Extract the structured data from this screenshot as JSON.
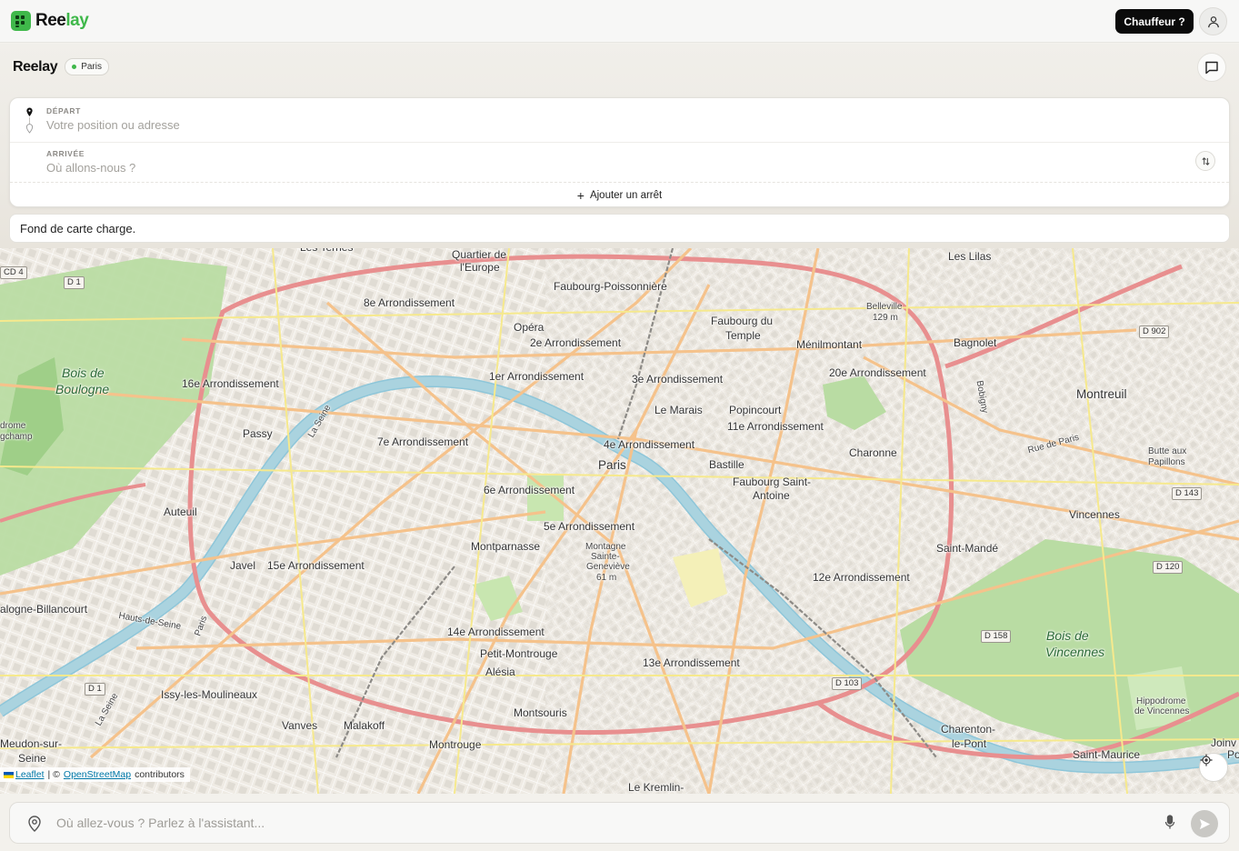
{
  "topbar": {
    "logo_part1": "Ree",
    "logo_part2": "lay",
    "driver_button": "Chauffeur ?",
    "icons": {
      "logo": "logo-icon",
      "user": "user-icon"
    }
  },
  "header": {
    "title": "Reelay",
    "city": "Paris",
    "icons": {
      "chat": "chat-bubble-icon"
    }
  },
  "route": {
    "departure_label": "DÉPART",
    "departure_placeholder": "Votre position ou adresse",
    "arrival_label": "ARRIVÉE",
    "arrival_placeholder": "Où allons-nous ?",
    "add_stop": "Ajouter un arrêt",
    "icons": {
      "departure": "map-pin-icon",
      "arrival": "map-pin-outline-icon",
      "swap": "swap-vertical-icon",
      "add": "plus-icon"
    }
  },
  "toast": {
    "message": "Fond de carte charge."
  },
  "map": {
    "labels": [
      {
        "text": "Quartier de",
        "cls": ""
      },
      {
        "text": "l'Europe",
        "cls": ""
      },
      {
        "text": "Faubourg-Poissonnière",
        "cls": ""
      },
      {
        "text": "Les Lilas",
        "cls": ""
      },
      {
        "text": "8e Arrondissement",
        "cls": ""
      },
      {
        "text": "Opéra",
        "cls": ""
      },
      {
        "text": "Faubourg du",
        "cls": ""
      },
      {
        "text": "Temple",
        "cls": ""
      },
      {
        "text": "Belleville",
        "cls": "small"
      },
      {
        "text": "129 m",
        "cls": "small"
      },
      {
        "text": "Ménilmontant",
        "cls": ""
      },
      {
        "text": "Bagnolet",
        "cls": ""
      },
      {
        "text": "2e Arrondissement",
        "cls": ""
      },
      {
        "text": "Bois de",
        "cls": "green"
      },
      {
        "text": "Boulogne",
        "cls": "green"
      },
      {
        "text": "1er Arrondissement",
        "cls": ""
      },
      {
        "text": "3e Arrondissement",
        "cls": ""
      },
      {
        "text": "20e Arrondissement",
        "cls": ""
      },
      {
        "text": "16e Arrondissement",
        "cls": ""
      },
      {
        "text": "Montreuil",
        "cls": "big"
      },
      {
        "text": "Le Marais",
        "cls": ""
      },
      {
        "text": "Popincourt",
        "cls": ""
      },
      {
        "text": "11e Arrondissement",
        "cls": ""
      },
      {
        "text": "Passy",
        "cls": ""
      },
      {
        "text": "7e Arrondissement",
        "cls": ""
      },
      {
        "text": "4e Arrondissement",
        "cls": ""
      },
      {
        "text": "Charonne",
        "cls": ""
      },
      {
        "text": "Butte aux",
        "cls": "small"
      },
      {
        "text": "Papillons",
        "cls": "small"
      },
      {
        "text": "Paris",
        "cls": "big"
      },
      {
        "text": "Bastille",
        "cls": ""
      },
      {
        "text": "Faubourg Saint-",
        "cls": ""
      },
      {
        "text": "Antoine",
        "cls": ""
      },
      {
        "text": "6e Arrondissement",
        "cls": ""
      },
      {
        "text": "Auteuil",
        "cls": ""
      },
      {
        "text": "Vincennes",
        "cls": ""
      },
      {
        "text": "5e Arrondissement",
        "cls": ""
      },
      {
        "text": "Montparnasse",
        "cls": ""
      },
      {
        "text": "Montagne",
        "cls": "small"
      },
      {
        "text": "Sainte-",
        "cls": "small"
      },
      {
        "text": "Geneviève",
        "cls": "small"
      },
      {
        "text": "61 m",
        "cls": "small"
      },
      {
        "text": "Saint-Mandé",
        "cls": ""
      },
      {
        "text": "Javel",
        "cls": ""
      },
      {
        "text": "15e Arrondissement",
        "cls": ""
      },
      {
        "text": "12e Arrondissement",
        "cls": ""
      },
      {
        "text": "alogne-Billancourt",
        "cls": ""
      },
      {
        "text": "14e Arrondissement",
        "cls": ""
      },
      {
        "text": "Bois de",
        "cls": "green"
      },
      {
        "text": "Vincennes",
        "cls": "green"
      },
      {
        "text": "Petit-Montrouge",
        "cls": ""
      },
      {
        "text": "13e Arrondissement",
        "cls": ""
      },
      {
        "text": "Alésia",
        "cls": ""
      },
      {
        "text": "Issy-les-Moulineaux",
        "cls": ""
      },
      {
        "text": "Hippodrome",
        "cls": "small"
      },
      {
        "text": "de Vincennes",
        "cls": "small"
      },
      {
        "text": "Vanves",
        "cls": ""
      },
      {
        "text": "Malakoff",
        "cls": ""
      },
      {
        "text": "Montsouris",
        "cls": ""
      },
      {
        "text": "Charenton-",
        "cls": ""
      },
      {
        "text": "le-Pont",
        "cls": ""
      },
      {
        "text": "Meudon-sur-",
        "cls": ""
      },
      {
        "text": "Seine",
        "cls": ""
      },
      {
        "text": "Montrouge",
        "cls": ""
      },
      {
        "text": "Saint-Maurice",
        "cls": ""
      },
      {
        "text": "Le Kremlin-",
        "cls": ""
      },
      {
        "text": "Les Ternes",
        "cls": ""
      },
      {
        "text": "Joinv",
        "cls": ""
      },
      {
        "text": "drome",
        "cls": "small"
      },
      {
        "text": "gchamp",
        "cls": "small"
      },
      {
        "text": "La Seine",
        "cls": "small"
      },
      {
        "text": "Bobigny",
        "cls": "small"
      },
      {
        "text": "Rue de Paris",
        "cls": "small"
      },
      {
        "text": "Hauts-de-Seine",
        "cls": "small"
      },
      {
        "text": "Paris",
        "cls": "small"
      },
      {
        "text": "La Seine",
        "cls": "small"
      },
      {
        "text": "Po",
        "cls": ""
      }
    ],
    "road_badges": [
      "CD 4",
      "D 1",
      "D 902",
      "D 143",
      "D 120",
      "D 158",
      "D 103",
      "D 1"
    ],
    "attribution": {
      "leaflet": "Leaflet",
      "separator": "| ©",
      "osm": "OpenStreetMap",
      "contributors": "contributors"
    },
    "icons": {
      "locate": "crosshair-locate-icon"
    }
  },
  "assistant": {
    "placeholder": "Où allez-vous ? Parlez à l'assistant...",
    "icons": {
      "pin": "map-pin-outline-icon",
      "mic": "microphone-icon",
      "send": "send-icon"
    }
  },
  "colors": {
    "brand_green": "#3fb84a",
    "dark_button": "#0b0b0b",
    "water": "#aad3df",
    "park": "#c8e6b0",
    "major_road": "#f7c38a",
    "motorway": "#e88f8f"
  }
}
